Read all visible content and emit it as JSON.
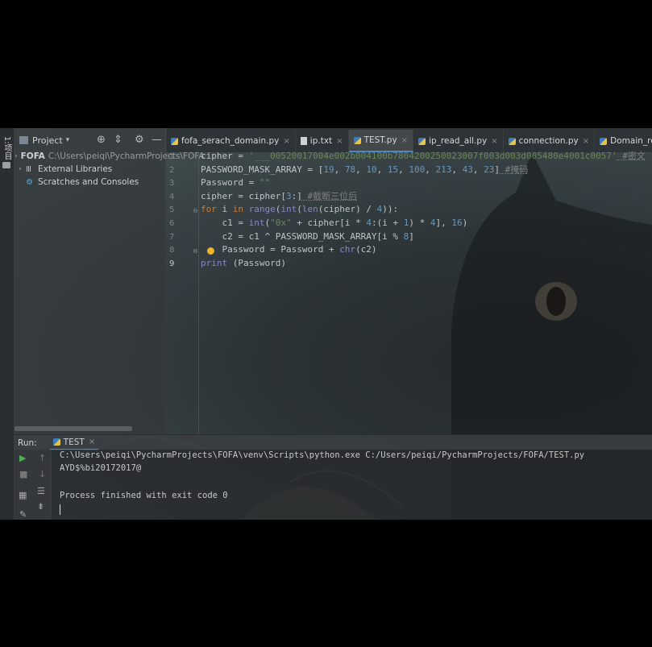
{
  "sidebar": {
    "stripe_label": "1:项目",
    "header_title": "Project",
    "tree": [
      {
        "label": "FOFA",
        "path": "C:\\Users\\peiqi\\PycharmProjects\\FOFA"
      },
      {
        "label": "External Libraries"
      },
      {
        "label": "Scratches and Consoles"
      }
    ]
  },
  "tabs": [
    {
      "label": "fofa_serach_domain.py",
      "type": "py"
    },
    {
      "label": "ip.txt",
      "type": "txt"
    },
    {
      "label": "TEST.py",
      "type": "py",
      "active": true
    },
    {
      "label": "ip_read_all.py",
      "type": "py"
    },
    {
      "label": "connection.py",
      "type": "py"
    },
    {
      "label": "Domain_revese.py",
      "type": "py"
    }
  ],
  "editor": {
    "line_numbers": [
      "1",
      "2",
      "3",
      "4",
      "5",
      "6",
      "7",
      "8",
      "9"
    ],
    "line1": {
      "a": "cipher = ",
      "b": "'___00520017004e002b004100b7804200250023007f003d003d005480e4001c0057'",
      "c": " #密文"
    },
    "line2": {
      "a": "PASSWORD_MASK_ARRAY = [",
      "n1": "19",
      "n2": "78",
      "n3": "10",
      "n4": "15",
      "n5": "100",
      "n6": "213",
      "n7": "43",
      "n8": "23",
      "e": "]",
      "c": " #掩码"
    },
    "line3": {
      "a": "Password = ",
      "b": "\"\""
    },
    "line4": {
      "a": "cipher = cipher[",
      "n": "3",
      "e": ":]",
      "c": " #截断三位后"
    },
    "line5": {
      "k1": "for",
      "a": " i ",
      "k2": "in",
      "f1": " range",
      "b": "(",
      "f2": "int",
      "c": "(",
      "f3": "len",
      "d": "(cipher) / ",
      "n": "4",
      "e": ")):"
    },
    "line6": {
      "a": "    c1 = ",
      "f": "int",
      "b": "(",
      "s": "\"0x\"",
      "c": " + cipher[i * ",
      "n1": "4",
      "d": ":(i + ",
      "n2": "1",
      "e": ") * ",
      "n3": "4",
      "g": "], ",
      "n4": "16",
      "h": ")"
    },
    "line7": {
      "a": "    c2 = c1 ^ PASSWORD_MASK_ARRAY[i % ",
      "n": "8",
      "e": "]"
    },
    "line8": {
      "a": "    Password = Password + ",
      "f": "chr",
      "e": "(c2)"
    },
    "line9": {
      "f": "print",
      "a": " (Password)"
    }
  },
  "run": {
    "label": "Run:",
    "tab": "TEST",
    "lines": [
      "C:\\Users\\peiqi\\PycharmProjects\\FOFA\\venv\\Scripts\\python.exe C:/Users/peiqi/PycharmProjects/FOFA/TEST.py",
      "AYD$%bi20172017@",
      "Process finished with exit code 0"
    ]
  }
}
